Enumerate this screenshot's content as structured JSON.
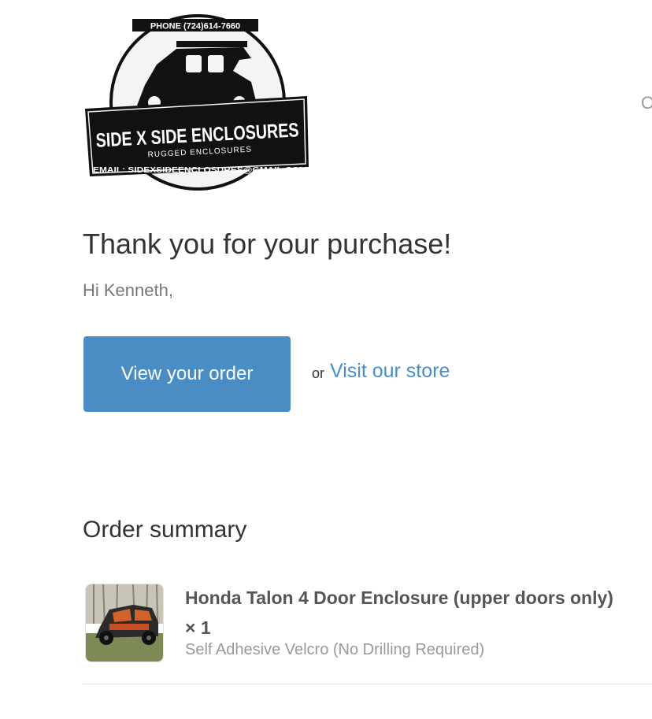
{
  "logo": {
    "phone": "PHONE (724)614-7660",
    "brand": "SIDE X SIDE ENCLOSURES",
    "tagline": "RUGGED ENCLOSURES",
    "email": "EMAIL: SIDEXSIDEENCLOSURES@GMAIL.COM"
  },
  "header": {
    "right_text": "O"
  },
  "hero": {
    "title": "Thank you for your purchase!",
    "greeting": "Hi Kenneth,"
  },
  "actions": {
    "view_order_label": "View your order",
    "or_text": "or",
    "visit_store_label": "Visit our store"
  },
  "order_summary": {
    "title": "Order summary",
    "items": [
      {
        "name": "Honda Talon 4 Door Enclosure (upper doors only) × 1",
        "variant": "Self Adhesive Velcro (No Drilling Required)"
      }
    ]
  },
  "colors": {
    "accent": "#4a8dc4",
    "text": "#333333",
    "muted": "#999999"
  }
}
